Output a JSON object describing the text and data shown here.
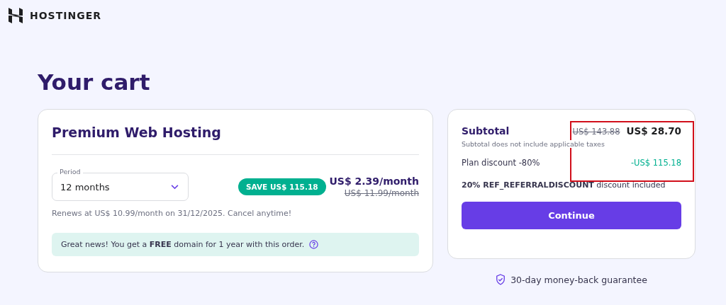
{
  "brand": {
    "name": "HOSTINGER"
  },
  "page_title": "Your cart",
  "product": {
    "name": "Premium Web Hosting",
    "period": {
      "label": "Period",
      "value": "12 months"
    },
    "savings_badge": "SAVE US$ 115.18",
    "price": "US$ 2.39/month",
    "old_price": "US$ 11.99/month",
    "renewal_note": "Renews at US$ 10.99/month on 31/12/2025. Cancel anytime!",
    "promo": "Great news! You get a **FREE** domain for 1 year with this order."
  },
  "summary": {
    "label": "Subtotal",
    "old_total": "US$ 143.88",
    "total": "US$ 28.70",
    "tax_note": "Subtotal does not include applicable taxes",
    "discount_label": "Plan discount -80%",
    "discount_amount": "-US$ 115.18",
    "referral_note": "**20% REF_REFERRALDISCOUNT** discount included",
    "button": "Continue",
    "annotation": {
      "kind": "highlight-box"
    }
  },
  "guarantee": "30-day money-back guarantee"
}
